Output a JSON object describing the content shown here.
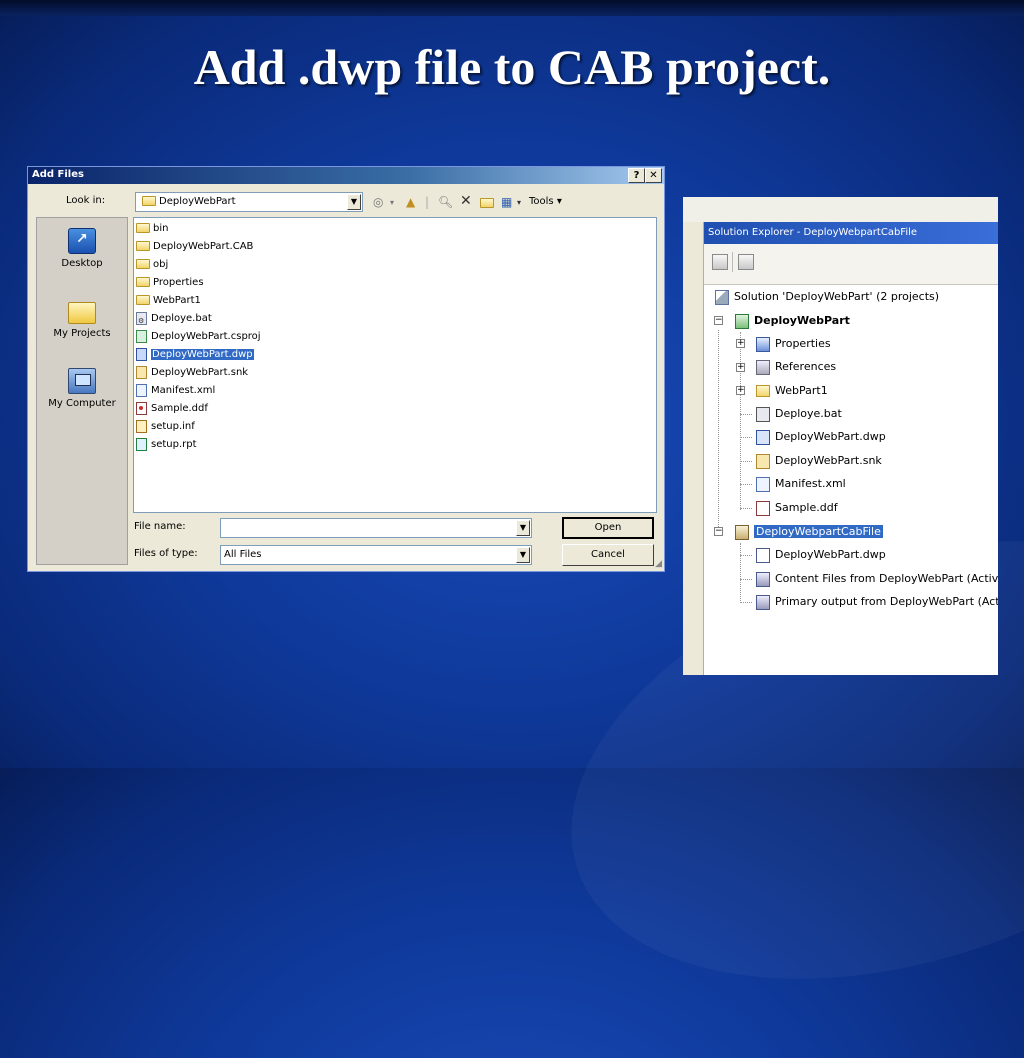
{
  "slide": {
    "title": "Add .dwp file to CAB project."
  },
  "dialog": {
    "title": "Add Files",
    "help_button": "?",
    "close_button": "✕",
    "lookin_label": "Look in:",
    "lookin_value": "DeployWebPart",
    "tools_label": "Tools",
    "places": [
      {
        "label": "Desktop",
        "icon": "desktop-icon"
      },
      {
        "label": "My Projects",
        "icon": "folder-icon"
      },
      {
        "label": "My Computer",
        "icon": "computer-icon"
      }
    ],
    "files": [
      {
        "name": "bin",
        "icon": "folder"
      },
      {
        "name": "DeployWebPart.CAB",
        "icon": "folder"
      },
      {
        "name": "obj",
        "icon": "folder"
      },
      {
        "name": "Properties",
        "icon": "folder"
      },
      {
        "name": "WebPart1",
        "icon": "folder"
      },
      {
        "name": "Deploye.bat",
        "icon": "bat"
      },
      {
        "name": "DeployWebPart.csproj",
        "icon": "csproj"
      },
      {
        "name": "DeployWebPart.dwp",
        "icon": "dwp",
        "selected": true
      },
      {
        "name": "DeployWebPart.snk",
        "icon": "snk"
      },
      {
        "name": "Manifest.xml",
        "icon": "xml"
      },
      {
        "name": "Sample.ddf",
        "icon": "ddf"
      },
      {
        "name": "setup.inf",
        "icon": "inf"
      },
      {
        "name": "setup.rpt",
        "icon": "rpt"
      }
    ],
    "filename_label": "File name:",
    "filename_value": "",
    "filetype_label": "Files of type:",
    "filetype_value": "All Files",
    "open_button": "Open",
    "cancel_button": "Cancel"
  },
  "solution_explorer": {
    "title": "Solution Explorer - DeployWebpartCabFile",
    "nodes": [
      {
        "label": "Solution 'DeployWebPart' (2 projects)",
        "icon": "solution"
      },
      {
        "label": "DeployWebPart",
        "icon": "project",
        "bold": true
      },
      {
        "label": "Properties",
        "icon": "props"
      },
      {
        "label": "References",
        "icon": "refs"
      },
      {
        "label": "WebPart1",
        "icon": "folder"
      },
      {
        "label": "Deploye.bat",
        "icon": "bat"
      },
      {
        "label": "DeployWebPart.dwp",
        "icon": "dwp"
      },
      {
        "label": "DeployWebPart.snk",
        "icon": "snk"
      },
      {
        "label": "Manifest.xml",
        "icon": "xml"
      },
      {
        "label": "Sample.ddf",
        "icon": "ddf"
      },
      {
        "label": "DeployWebpartCabFile",
        "icon": "cab",
        "selected": true
      },
      {
        "label": "DeployWebPart.dwp",
        "icon": "doc"
      },
      {
        "label": "Content Files from DeployWebPart (Active)",
        "icon": "output"
      },
      {
        "label": "Primary output from DeployWebPart (Active)",
        "icon": "output"
      }
    ]
  }
}
